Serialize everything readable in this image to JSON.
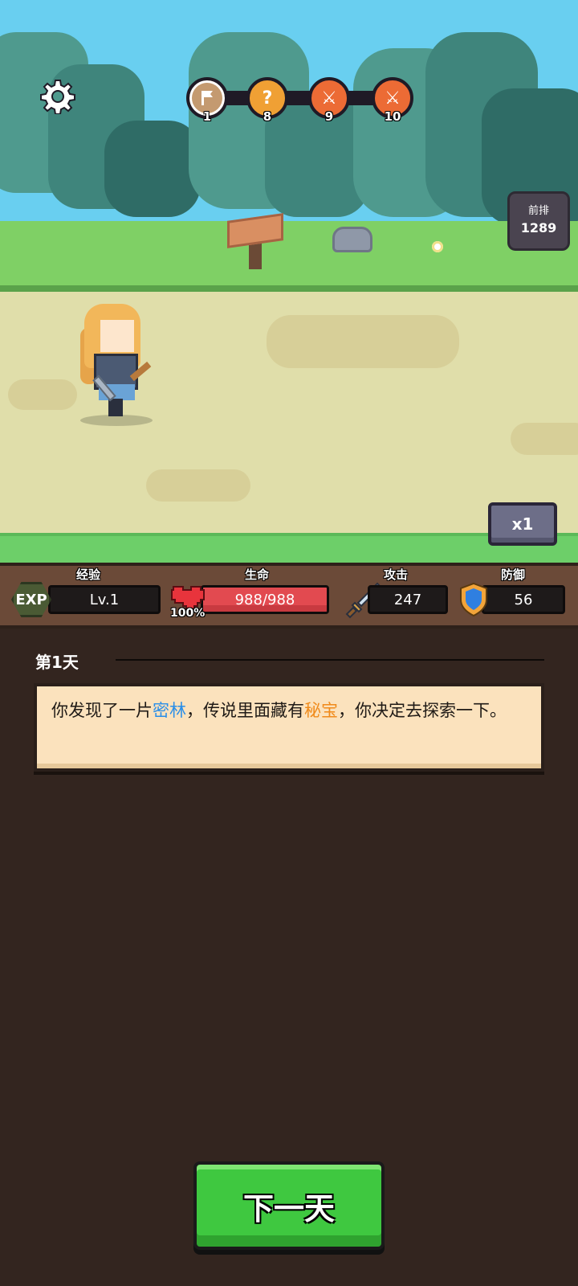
{
  "stages": [
    {
      "type": "current",
      "icon": "flag-icon",
      "number": "1"
    },
    {
      "type": "quest",
      "icon": "question-icon",
      "glyph": "?",
      "number": "8"
    },
    {
      "type": "battle",
      "icon": "crossed-swords-icon",
      "glyph": "⚔",
      "number": "9"
    },
    {
      "type": "battle",
      "icon": "crossed-swords-icon",
      "glyph": "⚔",
      "number": "10"
    }
  ],
  "ranking": {
    "label": "前排",
    "value": "1289"
  },
  "speed": {
    "label": "x1"
  },
  "stats": {
    "exp": {
      "label": "经验",
      "badge": "EXP",
      "value": "Lv.1"
    },
    "hp": {
      "label": "生命",
      "value": "988/988",
      "percent_text": "100%",
      "fraction": 1.0
    },
    "attack": {
      "label": "攻击",
      "value": "247"
    },
    "defense": {
      "label": "防御",
      "value": "56"
    }
  },
  "log": {
    "day": "第1天",
    "text_parts": [
      {
        "text": "你发现了一片",
        "style": "normal"
      },
      {
        "text": "密林",
        "style": "blue"
      },
      {
        "text": "，传说里面藏有",
        "style": "normal"
      },
      {
        "text": "秘宝",
        "style": "orange"
      },
      {
        "text": "，你决定去探索一下。",
        "style": "normal"
      }
    ]
  },
  "next_button": {
    "label": "下一天"
  },
  "colors": {
    "highlight_blue": "#2a8ee8",
    "highlight_orange": "#f08a1a",
    "button_green": "#3fc840",
    "hp_red": "#e24a50"
  }
}
